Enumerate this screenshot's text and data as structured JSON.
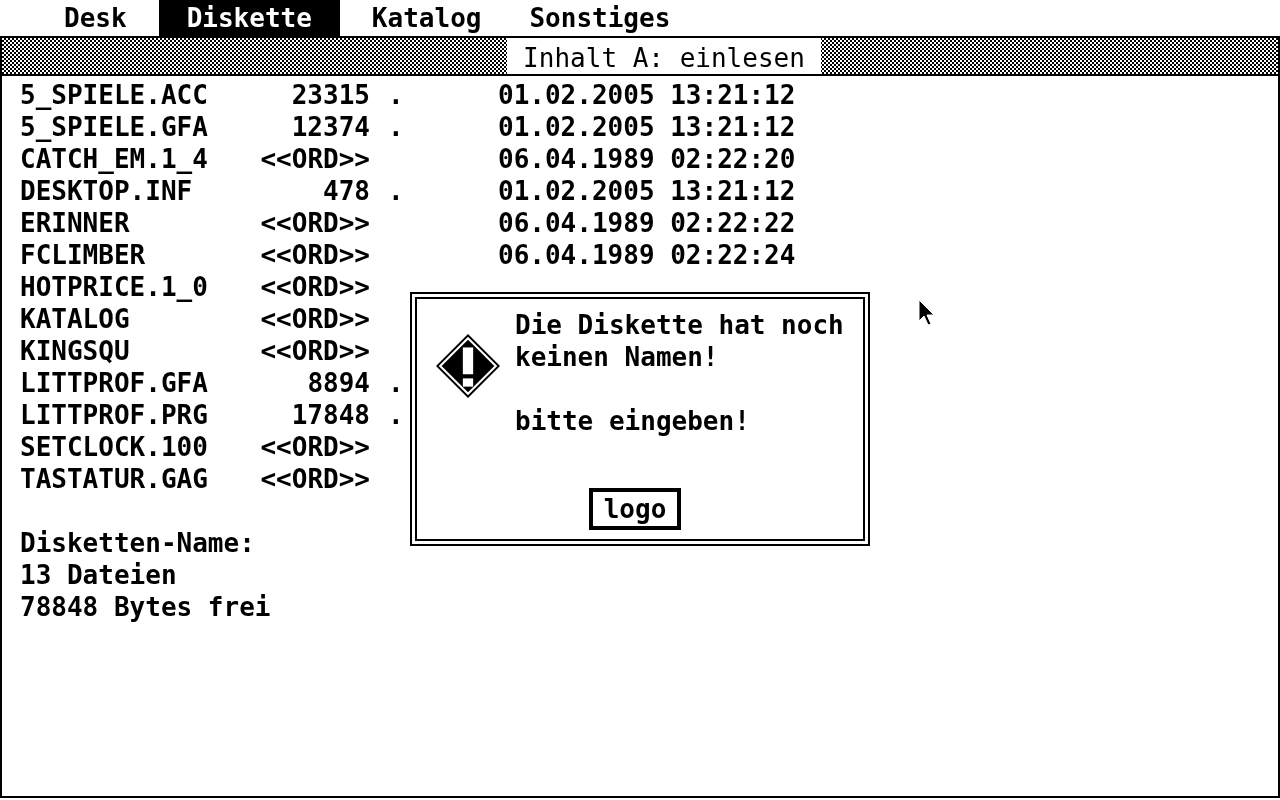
{
  "menu_bar": [
    {
      "label": "Desk",
      "selected": false
    },
    {
      "label": "Diskette",
      "selected": true
    },
    {
      "label": "Katalog",
      "selected": false
    },
    {
      "label": "Sonstiges",
      "selected": false
    }
  ],
  "window": {
    "title": "Inhalt A: einlesen",
    "files": [
      {
        "name": "5_SPIELE.ACC",
        "size": "23315",
        "flag": ".",
        "date": "01.02.2005 13:21:12"
      },
      {
        "name": "5_SPIELE.GFA",
        "size": "12374",
        "flag": ".",
        "date": "01.02.2005 13:21:12"
      },
      {
        "name": "CATCH_EM.1_4",
        "size": "<<ORD>>",
        "date": "06.04.1989 02:22:20"
      },
      {
        "name": "DESKTOP.INF",
        "size": "478",
        "flag": ".",
        "date": "01.02.2005 13:21:12"
      },
      {
        "name": "ERINNER",
        "size": "<<ORD>>",
        "date": "06.04.1989 02:22:22"
      },
      {
        "name": "FCLIMBER",
        "size": "<<ORD>>",
        "date": "06.04.1989 02:22:24"
      },
      {
        "name": "HOTPRICE.1_0",
        "size": "<<ORD>>"
      },
      {
        "name": "KATALOG",
        "size": "<<ORD>>"
      },
      {
        "name": "KINGSQU",
        "size": "<<ORD>>"
      },
      {
        "name": "LITTPROF.GFA",
        "size": "8894",
        "flag": "."
      },
      {
        "name": "LITTPROF.PRG",
        "size": "17848",
        "flag": "."
      },
      {
        "name": "SETCLOCK.100",
        "size": "<<ORD>>"
      },
      {
        "name": "TASTATUR.GAG",
        "size": "<<ORD>>"
      }
    ],
    "summary": [
      "Disketten-Name:",
      "13 Dateien",
      "78848 Bytes frei"
    ]
  },
  "dialog": {
    "paragraphs": [
      [
        "Die Diskette hat noch",
        "keinen Namen!"
      ],
      [
        "bitte eingeben!"
      ]
    ],
    "button": "logo"
  }
}
